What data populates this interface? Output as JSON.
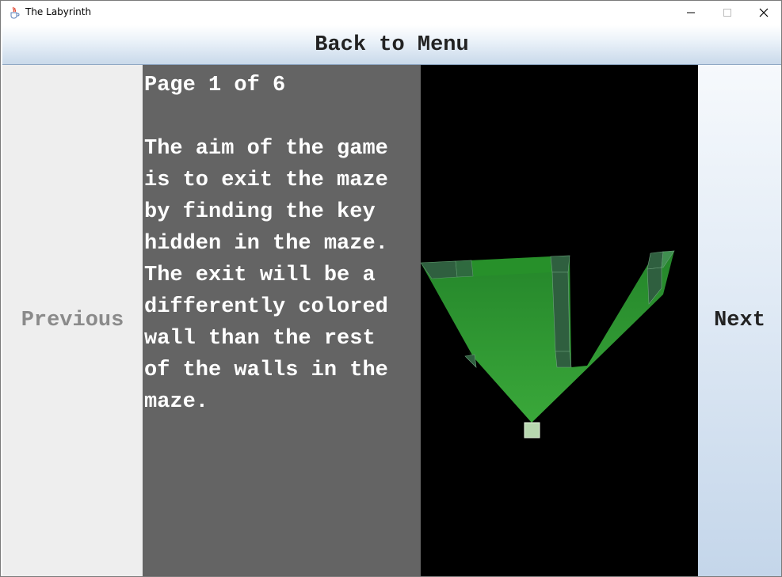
{
  "window": {
    "title": "The Labyrinth",
    "icon": "java-cup-icon",
    "controls": [
      "minimize-icon",
      "maximize-icon",
      "close-icon"
    ]
  },
  "header": {
    "back_label": "Back to Menu"
  },
  "navigation": {
    "previous_label": "Previous",
    "next_label": "Next",
    "previous_enabled": false
  },
  "instructions": {
    "page_indicator": "Page 1 of 6",
    "lines": [
      "The aim of the game",
      "is to exit the maze",
      "by finding the key",
      "hidden in the maze.",
      "The exit will be a",
      "differently colored",
      "wall than the rest",
      "of the walls in the",
      "maze."
    ]
  },
  "colors": {
    "text_panel_bg": "#646464",
    "maze_bg": "#000000",
    "maze_floor": "#2e9a2e",
    "maze_wall": "#2f5f3f"
  }
}
